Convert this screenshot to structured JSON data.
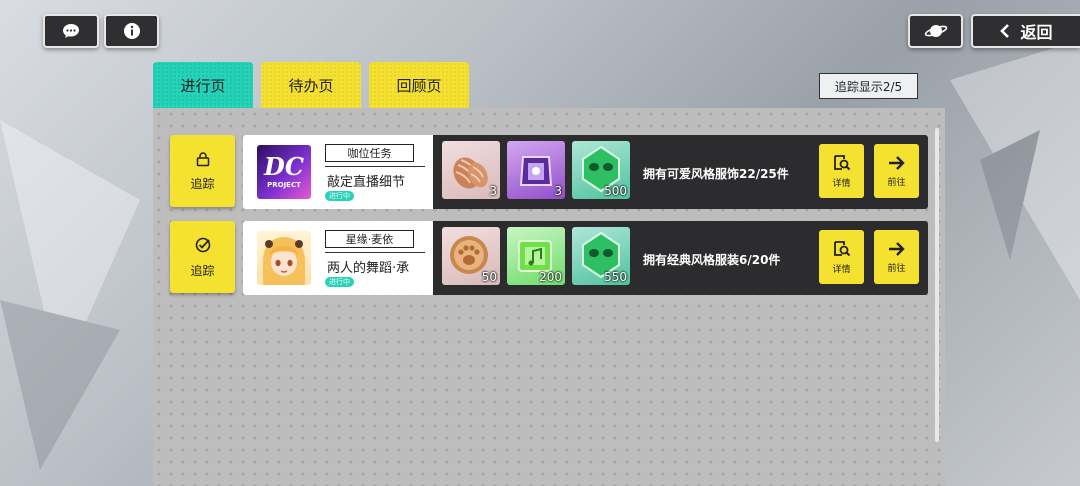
{
  "top": {
    "chat_icon": "chat-bubble-icon",
    "info_icon": "info-icon",
    "planet_icon": "planet-icon",
    "back_label": "返回"
  },
  "tabs": [
    {
      "label": "进行页",
      "active": true
    },
    {
      "label": "待办页",
      "active": false
    },
    {
      "label": "回顾页",
      "active": false
    }
  ],
  "track_count": "追踪显示2/5",
  "colors": {
    "accent_yellow": "#f5e130",
    "accent_teal": "#24d3b8",
    "dark_bar": "#2c2c2e"
  },
  "tasks": [
    {
      "track_label": "追踪",
      "track_icon": "lock-icon",
      "category": "咖位任务",
      "name": "敲定直播细节",
      "status": "进行中",
      "thumb_text": "DC",
      "thumb_sub": "PROJECT",
      "rewards": [
        {
          "icon": "yarn-icon",
          "count": "3"
        },
        {
          "icon": "purple-crate-icon",
          "count": "3"
        },
        {
          "icon": "green-token-icon",
          "count": "500"
        }
      ],
      "objective": "拥有可爱风格服饰22/25件",
      "detail_label": "详情",
      "goto_label": "前往"
    },
    {
      "track_label": "追踪",
      "track_icon": "check-circle-icon",
      "category": "星缘·麦依",
      "name": "两人的舞蹈·承",
      "status": "进行中",
      "rewards": [
        {
          "icon": "paw-coin-icon",
          "count": "50"
        },
        {
          "icon": "green-music-crate-icon",
          "count": "200"
        },
        {
          "icon": "green-token-icon",
          "count": "550"
        }
      ],
      "objective": "拥有经典风格服装6/20件",
      "detail_label": "详情",
      "goto_label": "前往"
    }
  ]
}
